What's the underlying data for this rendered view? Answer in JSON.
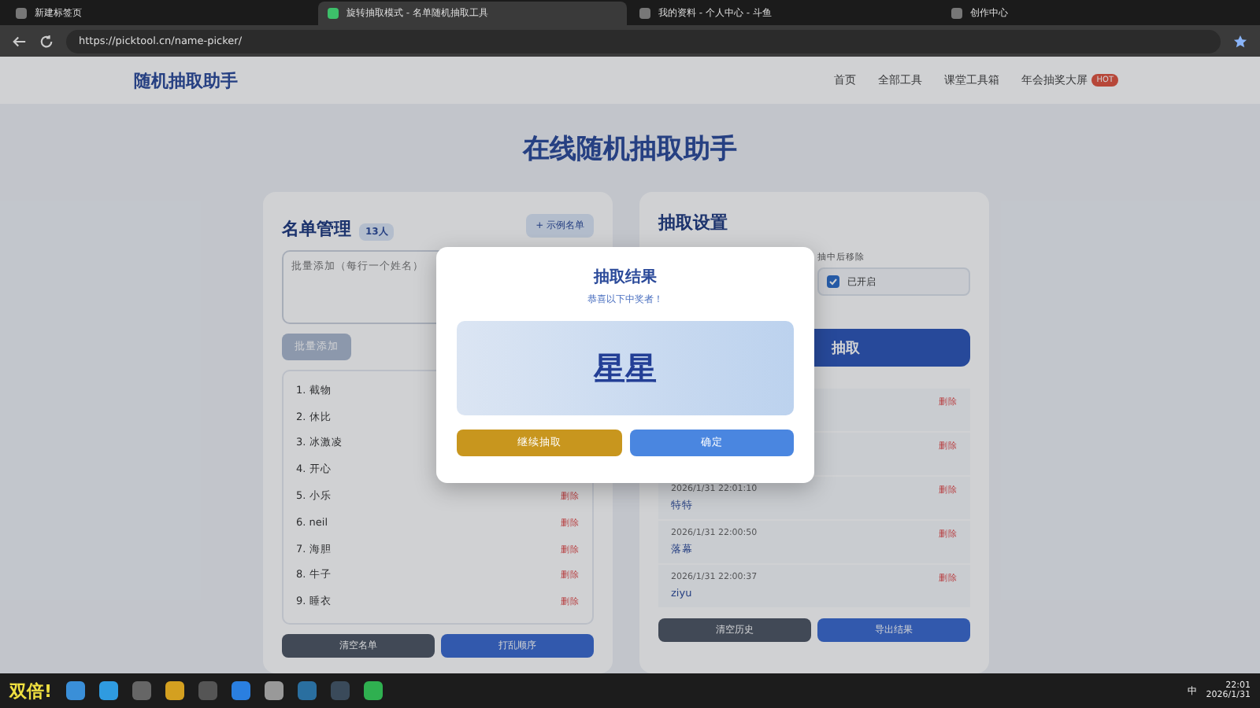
{
  "browser": {
    "tabs": [
      {
        "title": "新建标签页",
        "selected": false
      },
      {
        "title": "旋转抽取模式 - 名单随机抽取工具",
        "selected": true
      },
      {
        "title": "我的资料 - 个人中心 - 斗鱼",
        "selected": false
      },
      {
        "title": "创作中心",
        "selected": false
      }
    ],
    "url": "https://picktool.cn/name-picker/"
  },
  "header": {
    "logo": "随机抽取助手",
    "nav": [
      {
        "label": "首页"
      },
      {
        "label": "全部工具"
      },
      {
        "label": "课堂工具箱"
      },
      {
        "label": "年会抽奖大屏",
        "badge": "HOT"
      }
    ]
  },
  "page_title": "在线随机抽取助手",
  "roster": {
    "title": "名单管理",
    "count": "13人",
    "sample_button": "+ 示例名单",
    "placeholder": "批量添加（每行一个姓名）",
    "add_button": "批量添加",
    "items": [
      {
        "name": "1. 截物"
      },
      {
        "name": "2. 休比"
      },
      {
        "name": "3. 冰激凌"
      },
      {
        "name": "4. 开心"
      },
      {
        "name": "5. 小乐",
        "delete": "删除"
      },
      {
        "name": "6. neil",
        "delete": "删除"
      },
      {
        "name": "7. 海胆",
        "delete": "删除"
      },
      {
        "name": "8. 牛子",
        "delete": "删除"
      },
      {
        "name": "9. 睡衣",
        "delete": "删除"
      }
    ],
    "buttons": [
      {
        "label": "清空名单",
        "kind": "dark"
      },
      {
        "label": "打乱顺序",
        "kind": "primary"
      }
    ]
  },
  "settings": {
    "title": "抽取设置",
    "remove_label": "抽中后移除",
    "remove_checked": true,
    "remove_text": "已开启",
    "draw_button": "抽取",
    "history": [
      {
        "delete": "删除"
      },
      {
        "delete": "删除"
      },
      {
        "time": "2026/1/31 22:01:10",
        "name": "特特",
        "delete": "删除"
      },
      {
        "time": "2026/1/31 22:00:50",
        "name": "落幕",
        "delete": "删除"
      },
      {
        "time": "2026/1/31 22:00:37",
        "name": "ziyu",
        "delete": "删除"
      }
    ],
    "buttons": [
      {
        "label": "清空历史",
        "kind": "dark"
      },
      {
        "label": "导出结果",
        "kind": "primary"
      }
    ]
  },
  "dialog": {
    "title": "抽取结果",
    "subtitle": "恭喜以下中奖者！",
    "winner": "星星",
    "buttons": [
      {
        "label": "继续抽取",
        "kind": "gold"
      },
      {
        "label": "确定",
        "kind": "blue"
      }
    ]
  },
  "taskbar": {
    "overlay_text": "双倍!",
    "ime": "中",
    "time": "22:01",
    "date": "2026/1/31"
  }
}
